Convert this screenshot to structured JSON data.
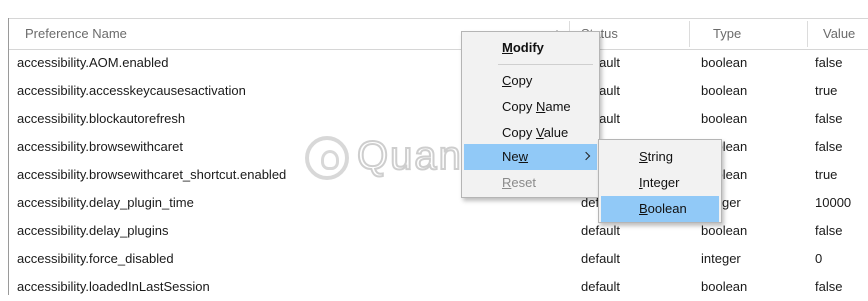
{
  "table": {
    "headers": {
      "name": "Preference Name",
      "status": "Status",
      "type": "Type",
      "value": "Value"
    },
    "rows": [
      {
        "name": "accessibility.AOM.enabled",
        "status": "default",
        "type": "boolean",
        "value": "false"
      },
      {
        "name": "accessibility.accesskeycausesactivation",
        "status": "default",
        "type": "boolean",
        "value": "true"
      },
      {
        "name": "accessibility.blockautorefresh",
        "status": "default",
        "type": "boolean",
        "value": "false"
      },
      {
        "name": "accessibility.browsewithcaret",
        "status": "default",
        "type": "boolean",
        "value": "false"
      },
      {
        "name": "accessibility.browsewithcaret_shortcut.enabled",
        "status": "default",
        "type": "boolean",
        "value": "true"
      },
      {
        "name": "accessibility.delay_plugin_time",
        "status": "default",
        "type": "integer",
        "value": "10000"
      },
      {
        "name": "accessibility.delay_plugins",
        "status": "default",
        "type": "boolean",
        "value": "false"
      },
      {
        "name": "accessibility.force_disabled",
        "status": "default",
        "type": "integer",
        "value": "0"
      },
      {
        "name": "accessibility.loadedInLastSession",
        "status": "default",
        "type": "boolean",
        "value": "false"
      }
    ]
  },
  "context_menu": {
    "items": [
      {
        "label": "Modify",
        "underline": "M",
        "bold": true
      },
      {
        "label": "Copy",
        "underline": "C"
      },
      {
        "label": "Copy Name",
        "underline": "N"
      },
      {
        "label": "Copy Value",
        "underline": "V"
      },
      {
        "label": "New",
        "underline": "w",
        "submenu": true,
        "highlighted": true
      },
      {
        "label": "Reset",
        "underline": "R",
        "disabled": true
      }
    ],
    "submenu": [
      {
        "label": "String",
        "underline": "S"
      },
      {
        "label": "Integer",
        "underline": "I"
      },
      {
        "label": "Boolean",
        "underline": "B",
        "highlighted": true
      }
    ]
  },
  "watermark": {
    "text": "Quantrimang"
  },
  "colors": {
    "highlight": "#91c9f7",
    "menu_bg": "#f2f2f2",
    "header_text": "#6b6b6b"
  }
}
